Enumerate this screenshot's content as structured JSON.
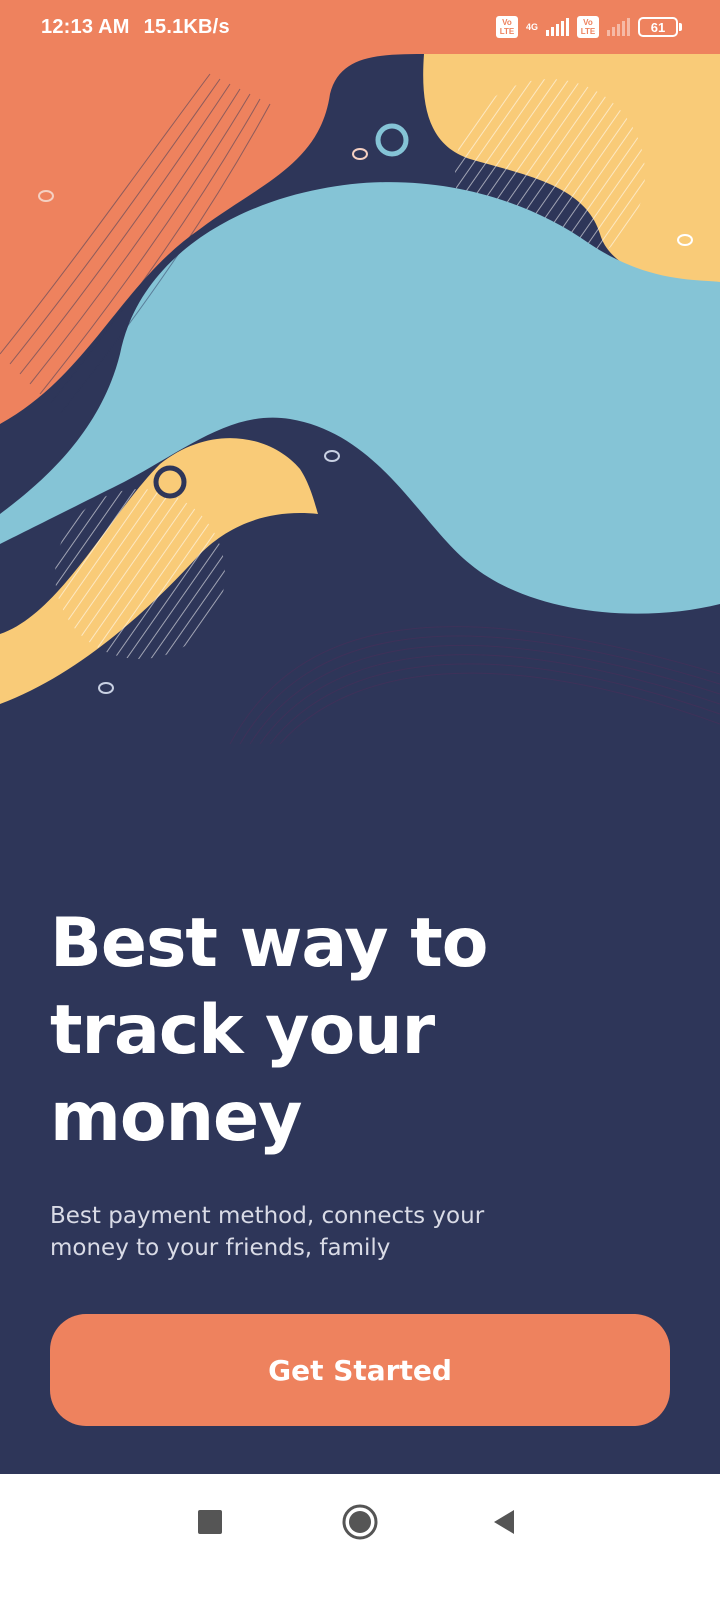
{
  "status_bar": {
    "time": "12:13 AM",
    "net_speed": "15.1KB/s",
    "volte_label_1": "Vo LTE",
    "network_type": "4G",
    "volte_label_2": "Vo LTE",
    "battery_level": "61"
  },
  "onboarding": {
    "headline_line1": "Best way to",
    "headline_line2": "track your",
    "headline_line3": "money",
    "subtext_line1": "Best payment method, connects your",
    "subtext_line2": "money to your friends, family",
    "cta_label": "Get Started"
  },
  "nav_bar": {
    "recents_icon": "square-icon",
    "home_icon": "circle-icon",
    "back_icon": "triangle-back-icon"
  },
  "colors": {
    "accent": "#ee825e",
    "background": "#2e3659",
    "light_blue": "#85c4d6",
    "yellow": "#f9cb78",
    "white": "#ffffff"
  }
}
